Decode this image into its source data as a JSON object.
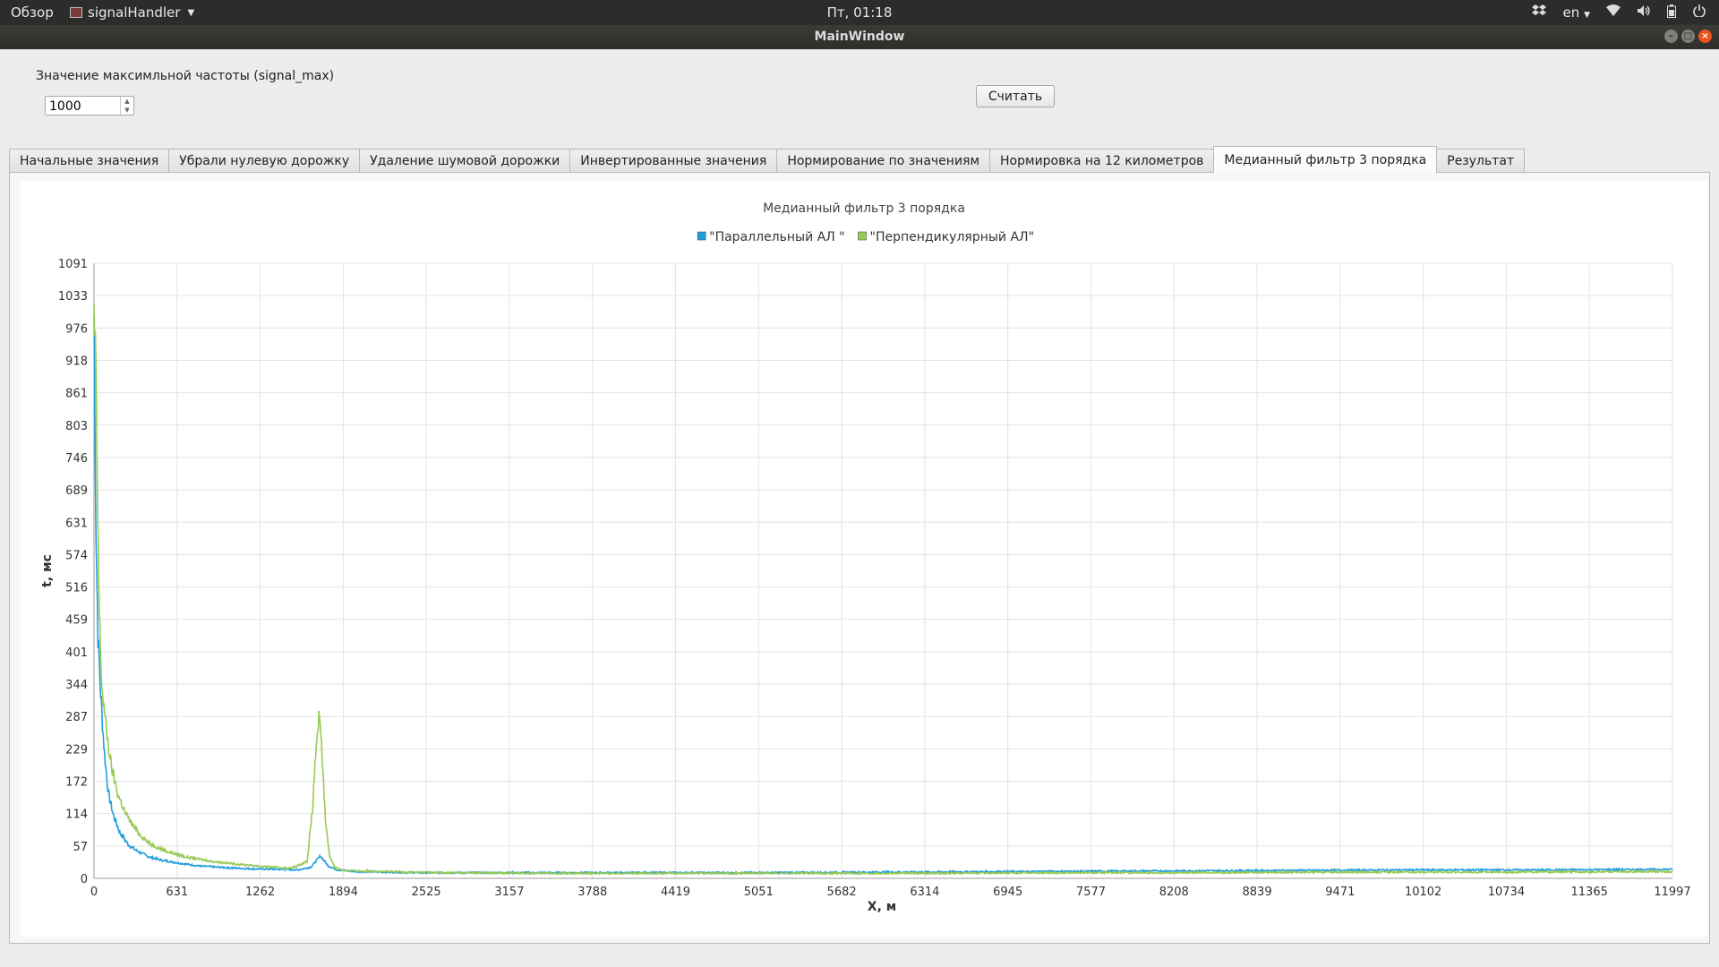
{
  "topbar": {
    "overview": "Обзор",
    "app_name": "signalHandler",
    "clock": "Пт, 01:18",
    "lang": "en",
    "icons": [
      "dropbox-icon",
      "wifi-icon",
      "volume-icon",
      "battery-icon",
      "power-icon"
    ]
  },
  "window": {
    "title": "MainWindow"
  },
  "form": {
    "label": "Значение максимльной частоты (signal_max)",
    "spin_value": "1000",
    "button": "Считать"
  },
  "tabs": [
    {
      "label": "Начальные значения"
    },
    {
      "label": "Убрали нулевую дорожку"
    },
    {
      "label": "Удаление шумовой дорожки"
    },
    {
      "label": "Инвертированные значения"
    },
    {
      "label": "Нормирование по значениям"
    },
    {
      "label": "Нормировка на 12 километров"
    },
    {
      "label": "Медианный фильтр 3 порядка",
      "active": true
    },
    {
      "label": "Результат"
    }
  ],
  "chart_data": {
    "type": "line",
    "title": "Медианный фильтр 3 порядка",
    "xlabel": "X, м",
    "ylabel": "t, мс",
    "xlim": [
      0,
      11997
    ],
    "ylim": [
      0,
      1091
    ],
    "xticks": [
      "0",
      "631",
      "1262",
      "1894",
      "2525",
      "3157",
      "3788",
      "4419",
      "5051",
      "5682",
      "6314",
      "6945",
      "7577",
      "8208",
      "8839",
      "9471",
      "10102",
      "10734",
      "11365",
      "11997"
    ],
    "yticks": [
      "0",
      "57",
      "114",
      "172",
      "229",
      "287",
      "344",
      "401",
      "459",
      "516",
      "574",
      "631",
      "689",
      "746",
      "803",
      "861",
      "918",
      "976",
      "1033",
      "1091"
    ],
    "grid": true,
    "legend_position": "top-center",
    "series": [
      {
        "name": "\"Параллельный АЛ \"",
        "color": "#209fdf",
        "points": [
          [
            0,
            1000
          ],
          [
            15,
            620
          ],
          [
            30,
            430
          ],
          [
            50,
            330
          ],
          [
            80,
            220
          ],
          [
            110,
            150
          ],
          [
            150,
            110
          ],
          [
            200,
            80
          ],
          [
            260,
            60
          ],
          [
            330,
            48
          ],
          [
            420,
            38
          ],
          [
            520,
            32
          ],
          [
            650,
            27
          ],
          [
            800,
            22
          ],
          [
            1000,
            19
          ],
          [
            1200,
            17
          ],
          [
            1400,
            16
          ],
          [
            1550,
            15
          ],
          [
            1650,
            20
          ],
          [
            1720,
            40
          ],
          [
            1780,
            22
          ],
          [
            1850,
            15
          ],
          [
            2000,
            12
          ],
          [
            2500,
            10
          ],
          [
            3000,
            10
          ],
          [
            4000,
            10
          ],
          [
            5000,
            10
          ],
          [
            6000,
            11
          ],
          [
            7000,
            12
          ],
          [
            8000,
            13
          ],
          [
            9000,
            14
          ],
          [
            10000,
            15
          ],
          [
            11000,
            15
          ],
          [
            11997,
            16
          ]
        ]
      },
      {
        "name": "\"Перпендикулярный АЛ\"",
        "color": "#99ca53",
        "points": [
          [
            0,
            990
          ],
          [
            12,
            930
          ],
          [
            25,
            700
          ],
          [
            40,
            470
          ],
          [
            60,
            340
          ],
          [
            90,
            270
          ],
          [
            130,
            200
          ],
          [
            180,
            150
          ],
          [
            240,
            115
          ],
          [
            320,
            85
          ],
          [
            420,
            62
          ],
          [
            550,
            48
          ],
          [
            700,
            38
          ],
          [
            900,
            30
          ],
          [
            1100,
            25
          ],
          [
            1300,
            21
          ],
          [
            1500,
            18
          ],
          [
            1620,
            30
          ],
          [
            1660,
            120
          ],
          [
            1690,
            240
          ],
          [
            1710,
            285
          ],
          [
            1730,
            230
          ],
          [
            1760,
            100
          ],
          [
            1790,
            40
          ],
          [
            1830,
            20
          ],
          [
            1900,
            14
          ],
          [
            2200,
            12
          ],
          [
            2700,
            10
          ],
          [
            3500,
            9
          ],
          [
            4500,
            9
          ],
          [
            5500,
            9
          ],
          [
            6500,
            9
          ],
          [
            7500,
            10
          ],
          [
            8500,
            10
          ],
          [
            9500,
            11
          ],
          [
            10500,
            11
          ],
          [
            11997,
            12
          ]
        ]
      }
    ]
  }
}
